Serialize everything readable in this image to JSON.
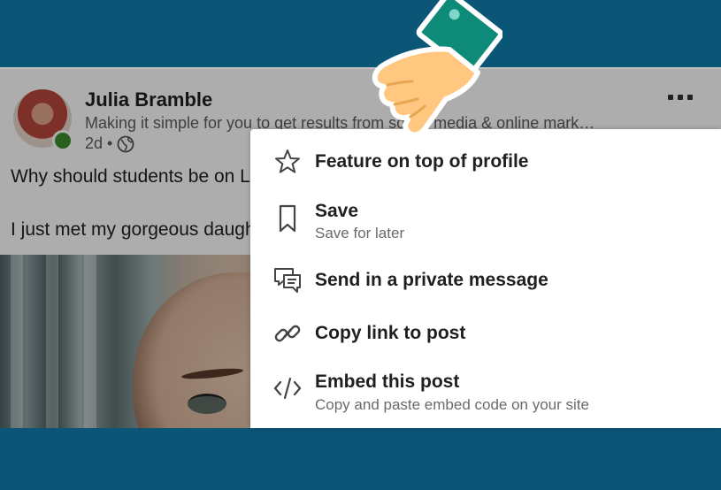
{
  "post": {
    "author_name": "Julia Bramble",
    "headline": "Making it simple for you to get results from social media & online mark…",
    "time": "2d",
    "separator": "•",
    "text_line_1": "Why should students be on LinkedIn?",
    "text_line_2": "I just met my gorgeous daughter"
  },
  "menu": {
    "items": [
      {
        "label": "Feature on top of profile",
        "sub": "",
        "icon": "star-icon"
      },
      {
        "label": "Save",
        "sub": "Save for later",
        "icon": "bookmark-icon"
      },
      {
        "label": "Send in a private message",
        "sub": "",
        "icon": "message-icon"
      },
      {
        "label": "Copy link to post",
        "sub": "",
        "icon": "link-icon"
      },
      {
        "label": "Embed this post",
        "sub": "Copy and paste embed code on your site",
        "icon": "code-icon"
      }
    ]
  },
  "colors": {
    "band": "#0b5677",
    "presence": "#3e8e2d",
    "hand_skin": "#ffc77f",
    "cuff": "#0e8a78"
  }
}
